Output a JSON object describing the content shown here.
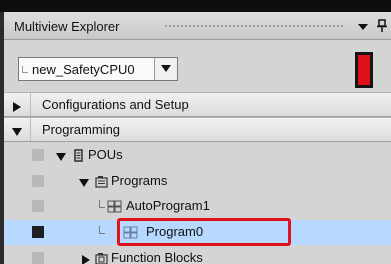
{
  "panel": {
    "title": "Multiview Explorer"
  },
  "device_selector": {
    "value": "new_SafetyCPU0"
  },
  "colors": {
    "safety_indicator": "#e10f1a",
    "selection_background": "#b7d9ff",
    "highlight_border": "#e0121c"
  },
  "tree": {
    "sections": [
      {
        "label": "Configurations and Setup",
        "expanded": false
      },
      {
        "label": "Programming",
        "expanded": true
      }
    ],
    "nodes": [
      {
        "label": "POUs",
        "icon": "pou-icon",
        "expanded": true
      },
      {
        "label": "Programs",
        "icon": "programs-folder-icon",
        "expanded": true
      },
      {
        "label": "AutoProgram1",
        "icon": "program-icon"
      },
      {
        "label": "Program0",
        "icon": "program-icon",
        "selected": true,
        "highlighted": true
      },
      {
        "label": "Function Blocks",
        "icon": "function-blocks-icon",
        "expanded": false
      }
    ]
  }
}
